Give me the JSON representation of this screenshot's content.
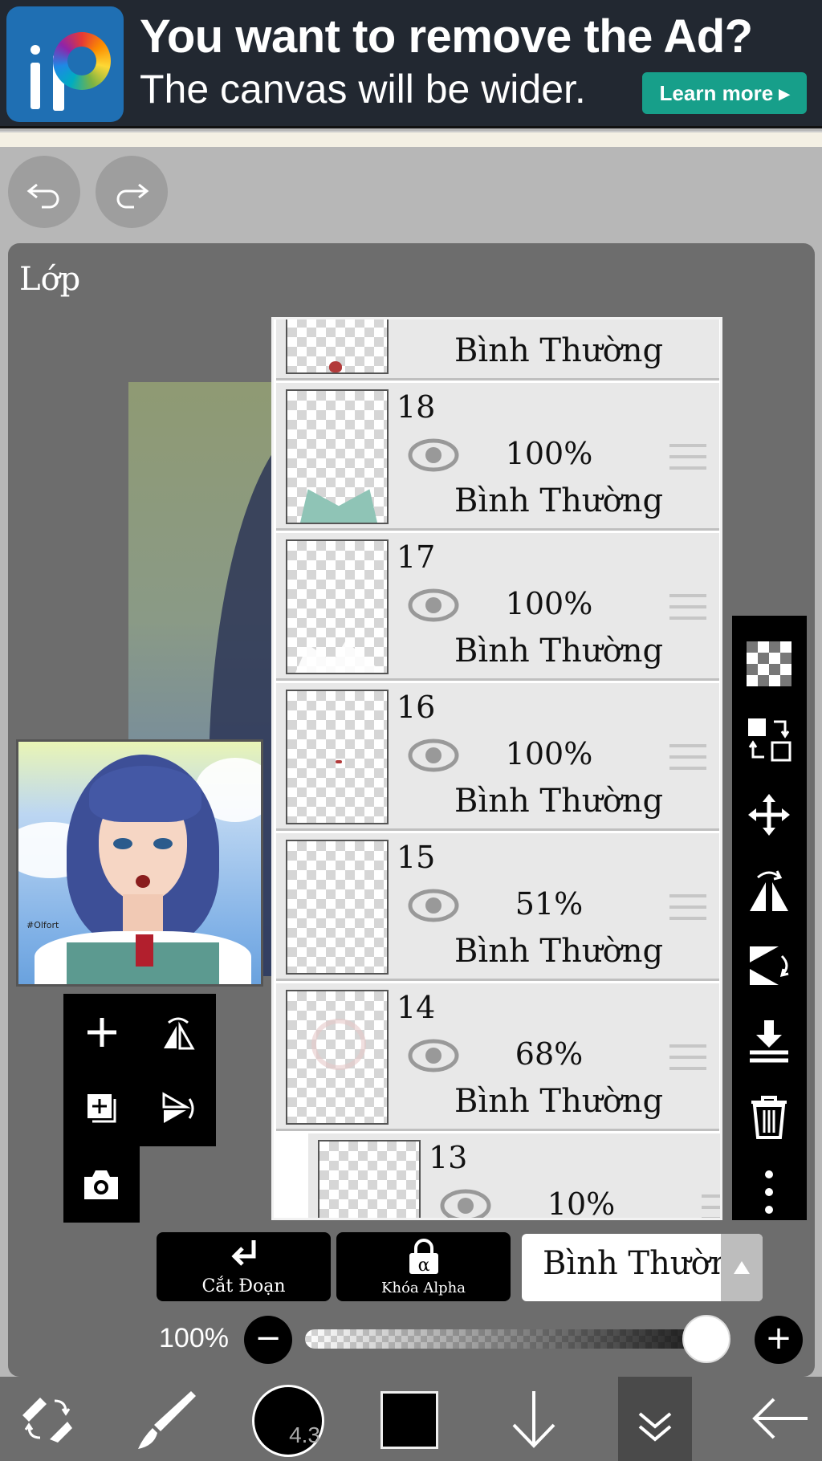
{
  "ad": {
    "title": "You want to remove the Ad?",
    "subtitle": "The canvas will be wider.",
    "button": "Learn more ▸"
  },
  "panel": {
    "title": "Lớp"
  },
  "thumbnail": {
    "signature": "#Olfort"
  },
  "layers": [
    {
      "number": "",
      "opacity": "",
      "blend": "Bình Thường"
    },
    {
      "number": "18",
      "opacity": "100%",
      "blend": "Bình Thường"
    },
    {
      "number": "17",
      "opacity": "100%",
      "blend": "Bình Thường"
    },
    {
      "number": "16",
      "opacity": "100%",
      "blend": "Bình Thường"
    },
    {
      "number": "15",
      "opacity": "51%",
      "blend": "Bình Thường"
    },
    {
      "number": "14",
      "opacity": "68%",
      "blend": "Bình Thường"
    },
    {
      "number": "13",
      "opacity": "10%",
      "blend": ""
    }
  ],
  "controls": {
    "clip_label": "Cắt Đoạn",
    "alpha_lock_label": "Khóa Alpha",
    "blend_mode": "Bình Thường",
    "opacity_label": "100%",
    "minus": "−",
    "plus": "+",
    "opacity_value": 1.0
  },
  "bottom_nav": {
    "brush_size": "4.3"
  },
  "colors": {
    "accent": "#179f8a",
    "panel": "#6d6d6d",
    "toolbar": "#000000"
  }
}
